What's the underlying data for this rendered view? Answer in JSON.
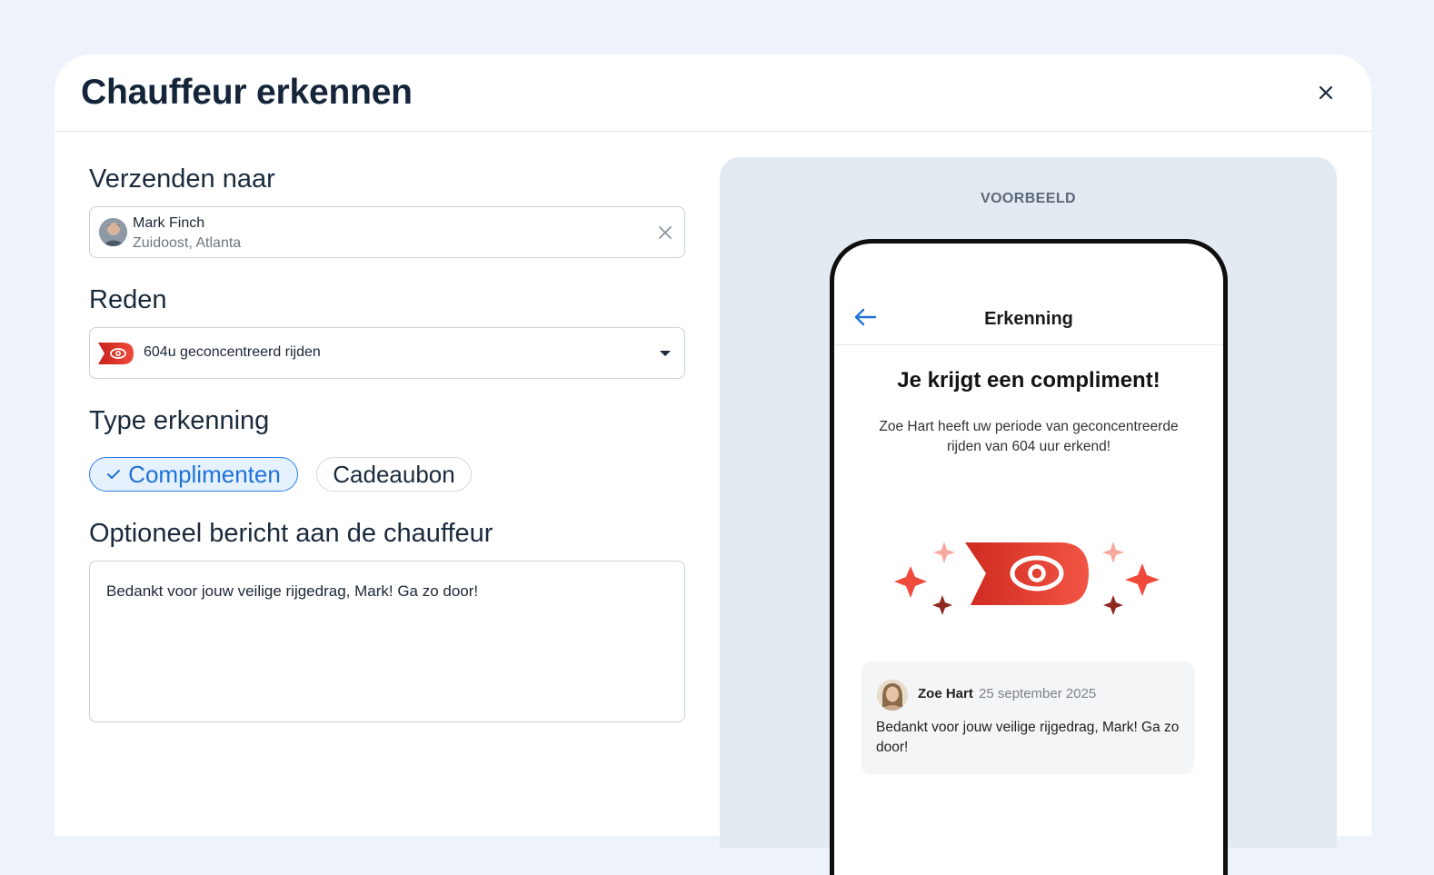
{
  "modal": {
    "title": "Chauffeur erkennen",
    "close_icon": "close-icon"
  },
  "form": {
    "recipient_label": "Verzenden naar",
    "recipient": {
      "name": "Mark Finch",
      "location": "Zuidoost, Atlanta"
    },
    "reason_label": "Reden",
    "reason_value": "604u geconcentreerd rijden",
    "type_label": "Type erkenning",
    "type_options": [
      {
        "label": "Complimenten",
        "selected": true
      },
      {
        "label": "Cadeaubon",
        "selected": false
      }
    ],
    "message_label": "Optioneel bericht aan de chauffeur",
    "message_value": "Bedankt voor jouw veilige rijgedrag, Mark! Ga zo door!"
  },
  "preview": {
    "label": "VOORBEELD",
    "phone": {
      "title": "Erkenning",
      "heading": "Je krijgt een compliment!",
      "body": "Zoe Hart heeft uw periode van geconcentreerde rijden van 604 uur erkend!",
      "comment": {
        "author": "Zoe Hart",
        "date": "25 september 2025",
        "text": "Bedankt voor jouw veilige rijgedrag, Mark! Ga zo door!"
      }
    }
  },
  "colors": {
    "accent_blue": "#2a7de1",
    "badge_red": "#e03a2e",
    "page_bg": "#eef3fb"
  }
}
